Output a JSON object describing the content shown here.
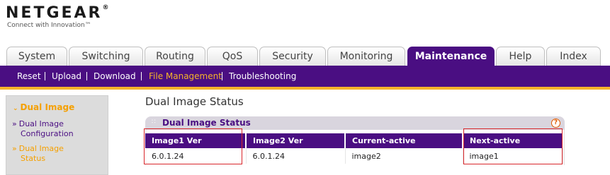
{
  "brand": {
    "name": "NETGEAR",
    "reg": "®",
    "tagline": "Connect with Innovation™"
  },
  "tabs": [
    {
      "label": "System"
    },
    {
      "label": "Switching"
    },
    {
      "label": "Routing"
    },
    {
      "label": "QoS"
    },
    {
      "label": "Security"
    },
    {
      "label": "Monitoring"
    },
    {
      "label": "Maintenance",
      "active": true
    },
    {
      "label": "Help"
    },
    {
      "label": "Index"
    }
  ],
  "subnav": [
    {
      "label": "Reset"
    },
    {
      "label": "Upload"
    },
    {
      "label": "Download"
    },
    {
      "label": "File Management",
      "active": true
    },
    {
      "label": "Troubleshooting"
    }
  ],
  "leftnav": {
    "heading": "Dual Image",
    "heading_icon": "chevron-down-icon",
    "items": [
      {
        "bullet": "»",
        "line1": "Dual Image",
        "line2": "Configuration"
      },
      {
        "bullet": "»",
        "line1": "Dual Image",
        "line2": "Status",
        "active": true
      }
    ]
  },
  "main": {
    "page_title": "Dual Image Status",
    "panel_title": "Dual Image Status",
    "help_glyph": "?",
    "columns": [
      "Image1 Ver",
      "Image2 Ver",
      "Current-active",
      "Next-active"
    ],
    "rows": [
      [
        "6.0.1.24",
        "6.0.1.24",
        "image2",
        "image1"
      ]
    ]
  },
  "colors": {
    "primary": "#4a0e82",
    "accent": "#f5b32a",
    "highlight": "#d9262b"
  }
}
